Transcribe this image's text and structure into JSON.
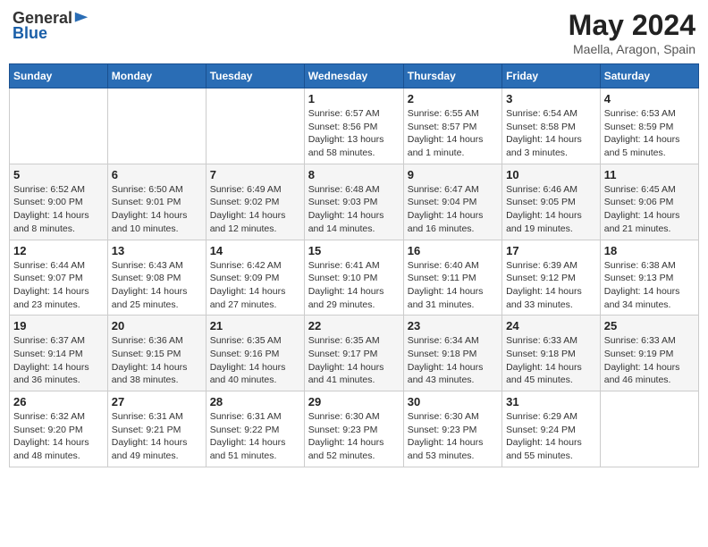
{
  "logo": {
    "general": "General",
    "blue": "Blue"
  },
  "header": {
    "month": "May 2024",
    "location": "Maella, Aragon, Spain"
  },
  "weekdays": [
    "Sunday",
    "Monday",
    "Tuesday",
    "Wednesday",
    "Thursday",
    "Friday",
    "Saturday"
  ],
  "weeks": [
    [
      {
        "day": "",
        "info": ""
      },
      {
        "day": "",
        "info": ""
      },
      {
        "day": "",
        "info": ""
      },
      {
        "day": "1",
        "info": "Sunrise: 6:57 AM\nSunset: 8:56 PM\nDaylight: 13 hours\nand 58 minutes."
      },
      {
        "day": "2",
        "info": "Sunrise: 6:55 AM\nSunset: 8:57 PM\nDaylight: 14 hours\nand 1 minute."
      },
      {
        "day": "3",
        "info": "Sunrise: 6:54 AM\nSunset: 8:58 PM\nDaylight: 14 hours\nand 3 minutes."
      },
      {
        "day": "4",
        "info": "Sunrise: 6:53 AM\nSunset: 8:59 PM\nDaylight: 14 hours\nand 5 minutes."
      }
    ],
    [
      {
        "day": "5",
        "info": "Sunrise: 6:52 AM\nSunset: 9:00 PM\nDaylight: 14 hours\nand 8 minutes."
      },
      {
        "day": "6",
        "info": "Sunrise: 6:50 AM\nSunset: 9:01 PM\nDaylight: 14 hours\nand 10 minutes."
      },
      {
        "day": "7",
        "info": "Sunrise: 6:49 AM\nSunset: 9:02 PM\nDaylight: 14 hours\nand 12 minutes."
      },
      {
        "day": "8",
        "info": "Sunrise: 6:48 AM\nSunset: 9:03 PM\nDaylight: 14 hours\nand 14 minutes."
      },
      {
        "day": "9",
        "info": "Sunrise: 6:47 AM\nSunset: 9:04 PM\nDaylight: 14 hours\nand 16 minutes."
      },
      {
        "day": "10",
        "info": "Sunrise: 6:46 AM\nSunset: 9:05 PM\nDaylight: 14 hours\nand 19 minutes."
      },
      {
        "day": "11",
        "info": "Sunrise: 6:45 AM\nSunset: 9:06 PM\nDaylight: 14 hours\nand 21 minutes."
      }
    ],
    [
      {
        "day": "12",
        "info": "Sunrise: 6:44 AM\nSunset: 9:07 PM\nDaylight: 14 hours\nand 23 minutes."
      },
      {
        "day": "13",
        "info": "Sunrise: 6:43 AM\nSunset: 9:08 PM\nDaylight: 14 hours\nand 25 minutes."
      },
      {
        "day": "14",
        "info": "Sunrise: 6:42 AM\nSunset: 9:09 PM\nDaylight: 14 hours\nand 27 minutes."
      },
      {
        "day": "15",
        "info": "Sunrise: 6:41 AM\nSunset: 9:10 PM\nDaylight: 14 hours\nand 29 minutes."
      },
      {
        "day": "16",
        "info": "Sunrise: 6:40 AM\nSunset: 9:11 PM\nDaylight: 14 hours\nand 31 minutes."
      },
      {
        "day": "17",
        "info": "Sunrise: 6:39 AM\nSunset: 9:12 PM\nDaylight: 14 hours\nand 33 minutes."
      },
      {
        "day": "18",
        "info": "Sunrise: 6:38 AM\nSunset: 9:13 PM\nDaylight: 14 hours\nand 34 minutes."
      }
    ],
    [
      {
        "day": "19",
        "info": "Sunrise: 6:37 AM\nSunset: 9:14 PM\nDaylight: 14 hours\nand 36 minutes."
      },
      {
        "day": "20",
        "info": "Sunrise: 6:36 AM\nSunset: 9:15 PM\nDaylight: 14 hours\nand 38 minutes."
      },
      {
        "day": "21",
        "info": "Sunrise: 6:35 AM\nSunset: 9:16 PM\nDaylight: 14 hours\nand 40 minutes."
      },
      {
        "day": "22",
        "info": "Sunrise: 6:35 AM\nSunset: 9:17 PM\nDaylight: 14 hours\nand 41 minutes."
      },
      {
        "day": "23",
        "info": "Sunrise: 6:34 AM\nSunset: 9:18 PM\nDaylight: 14 hours\nand 43 minutes."
      },
      {
        "day": "24",
        "info": "Sunrise: 6:33 AM\nSunset: 9:18 PM\nDaylight: 14 hours\nand 45 minutes."
      },
      {
        "day": "25",
        "info": "Sunrise: 6:33 AM\nSunset: 9:19 PM\nDaylight: 14 hours\nand 46 minutes."
      }
    ],
    [
      {
        "day": "26",
        "info": "Sunrise: 6:32 AM\nSunset: 9:20 PM\nDaylight: 14 hours\nand 48 minutes."
      },
      {
        "day": "27",
        "info": "Sunrise: 6:31 AM\nSunset: 9:21 PM\nDaylight: 14 hours\nand 49 minutes."
      },
      {
        "day": "28",
        "info": "Sunrise: 6:31 AM\nSunset: 9:22 PM\nDaylight: 14 hours\nand 51 minutes."
      },
      {
        "day": "29",
        "info": "Sunrise: 6:30 AM\nSunset: 9:23 PM\nDaylight: 14 hours\nand 52 minutes."
      },
      {
        "day": "30",
        "info": "Sunrise: 6:30 AM\nSunset: 9:23 PM\nDaylight: 14 hours\nand 53 minutes."
      },
      {
        "day": "31",
        "info": "Sunrise: 6:29 AM\nSunset: 9:24 PM\nDaylight: 14 hours\nand 55 minutes."
      },
      {
        "day": "",
        "info": ""
      }
    ]
  ]
}
